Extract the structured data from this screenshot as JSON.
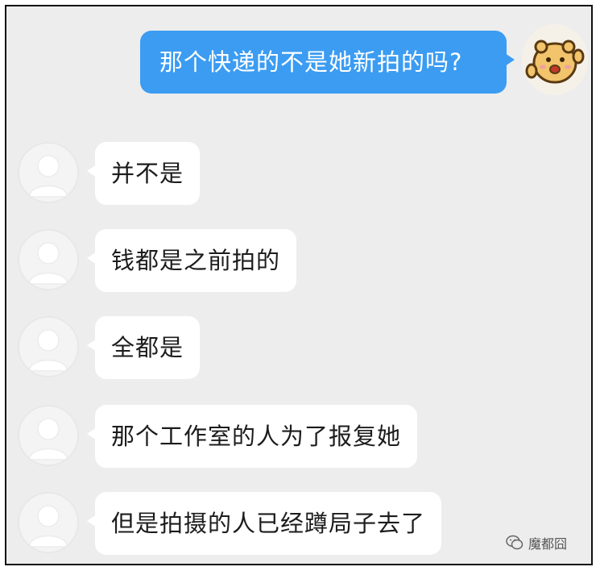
{
  "chat": {
    "outgoing": {
      "text": "那个快递的不是她新拍的吗?",
      "bubble_color": "#3b9cf2",
      "avatar_icon": "cartoon-bear-icon"
    },
    "incoming": [
      {
        "text": "并不是"
      },
      {
        "text": "钱都是之前拍的"
      },
      {
        "text": "全都是"
      },
      {
        "text": "那个工作室的人为了报复她"
      },
      {
        "text": "但是拍摄的人已经蹲局子去了"
      }
    ],
    "incoming_avatar_icon": "default-person-icon",
    "background_color": "#ededed"
  },
  "watermark": {
    "icon": "wechat-icon",
    "text": "魔都囧"
  }
}
